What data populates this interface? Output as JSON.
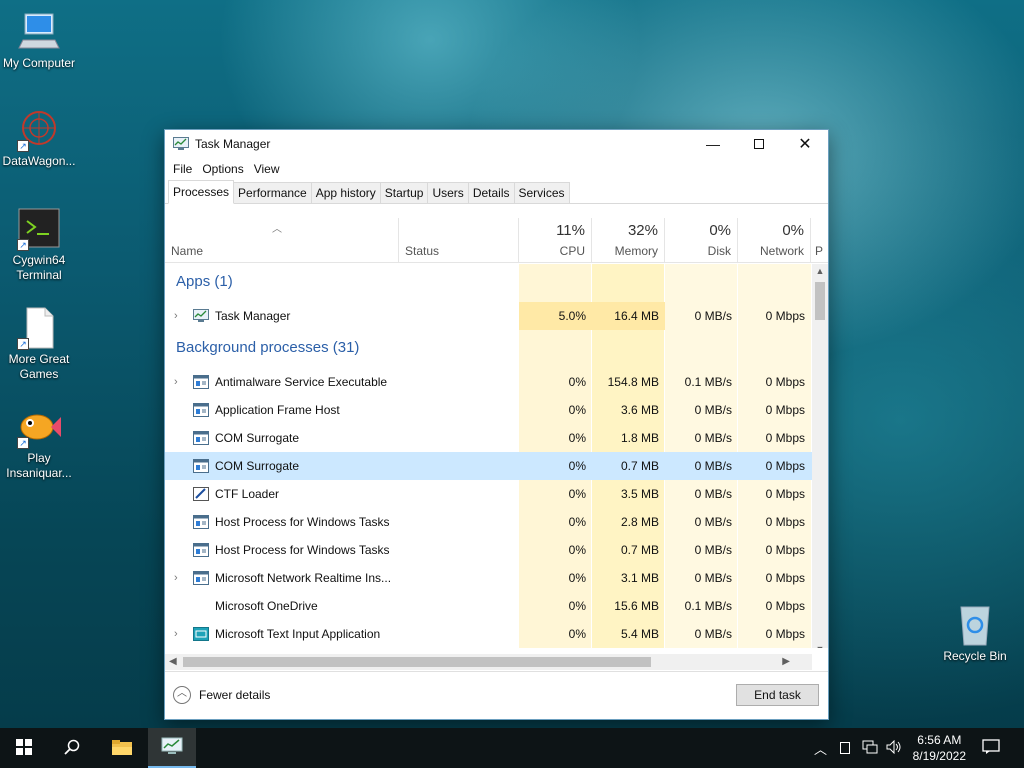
{
  "desktop": {
    "icons": [
      {
        "label": "My Computer"
      },
      {
        "label": "DataWagon..."
      },
      {
        "label": "Cygwin64 Terminal"
      },
      {
        "label": "More Great Games"
      },
      {
        "label": "Play Insaniquar..."
      },
      {
        "label": "Recycle Bin"
      }
    ]
  },
  "window": {
    "title": "Task Manager",
    "menu": [
      "File",
      "Options",
      "View"
    ],
    "tabs": [
      "Processes",
      "Performance",
      "App history",
      "Startup",
      "Users",
      "Details",
      "Services"
    ],
    "active_tab": "Processes"
  },
  "columns": {
    "name": "Name",
    "status": "Status",
    "cpu": {
      "pct": "11%",
      "label": "CPU"
    },
    "memory": {
      "pct": "32%",
      "label": "Memory"
    },
    "disk": {
      "pct": "0%",
      "label": "Disk"
    },
    "network": {
      "pct": "0%",
      "label": "Network"
    },
    "power": "P"
  },
  "groups": {
    "apps": "Apps (1)",
    "background": "Background processes (31)"
  },
  "app_rows": [
    {
      "name": "Task Manager",
      "cpu": "5.0%",
      "memory": "16.4 MB",
      "disk": "0 MB/s",
      "network": "0 Mbps",
      "expandable": true
    }
  ],
  "bg_rows": [
    {
      "name": "Antimalware Service Executable",
      "cpu": "0%",
      "memory": "154.8 MB",
      "disk": "0.1 MB/s",
      "network": "0 Mbps",
      "expandable": true
    },
    {
      "name": "Application Frame Host",
      "cpu": "0%",
      "memory": "3.6 MB",
      "disk": "0 MB/s",
      "network": "0 Mbps",
      "expandable": false
    },
    {
      "name": "COM Surrogate",
      "cpu": "0%",
      "memory": "1.8 MB",
      "disk": "0 MB/s",
      "network": "0 Mbps",
      "expandable": false
    },
    {
      "name": "COM Surrogate",
      "cpu": "0%",
      "memory": "0.7 MB",
      "disk": "0 MB/s",
      "network": "0 Mbps",
      "expandable": false,
      "selected": true
    },
    {
      "name": "CTF Loader",
      "cpu": "0%",
      "memory": "3.5 MB",
      "disk": "0 MB/s",
      "network": "0 Mbps",
      "expandable": false,
      "icon": "pen"
    },
    {
      "name": "Host Process for Windows Tasks",
      "cpu": "0%",
      "memory": "2.8 MB",
      "disk": "0 MB/s",
      "network": "0 Mbps",
      "expandable": false
    },
    {
      "name": "Host Process for Windows Tasks",
      "cpu": "0%",
      "memory": "0.7 MB",
      "disk": "0 MB/s",
      "network": "0 Mbps",
      "expandable": false
    },
    {
      "name": "Microsoft Network Realtime Ins...",
      "cpu": "0%",
      "memory": "3.1 MB",
      "disk": "0 MB/s",
      "network": "0 Mbps",
      "expandable": true
    },
    {
      "name": "Microsoft OneDrive",
      "cpu": "0%",
      "memory": "15.6 MB",
      "disk": "0.1 MB/s",
      "network": "0 Mbps",
      "expandable": false,
      "icon": "none"
    },
    {
      "name": "Microsoft Text Input Application",
      "cpu": "0%",
      "memory": "5.4 MB",
      "disk": "0 MB/s",
      "network": "0 Mbps",
      "expandable": true,
      "icon": "teal"
    }
  ],
  "footer": {
    "fewer_details": "Fewer details",
    "end_task": "End task"
  },
  "taskbar": {
    "time": "6:56 AM",
    "date": "8/19/2022"
  },
  "colors": {
    "heat_light": "#fff9e1",
    "heat_medium": "#fff4c4",
    "heat_strong": "#ffe9a6",
    "selection": "#cce8ff",
    "group_text": "#2b5fa8"
  }
}
